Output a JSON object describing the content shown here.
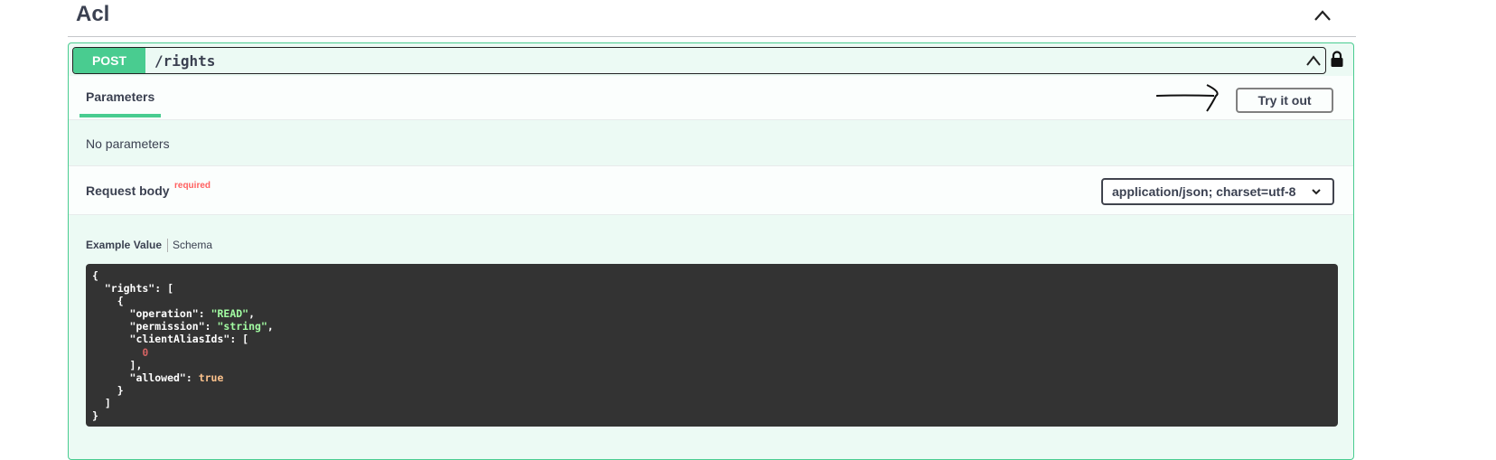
{
  "tag": {
    "title": "Acl"
  },
  "operation": {
    "method": "POST",
    "path": "/rights",
    "method_color": "#49cc90"
  },
  "parameters": {
    "tab_label": "Parameters",
    "try_button": "Try it out",
    "empty_text": "No parameters"
  },
  "request_body": {
    "title": "Request body",
    "required_label": "required",
    "content_type": "application/json; charset=utf-8"
  },
  "example": {
    "example_tab": "Example Value",
    "schema_tab": "Schema",
    "lines": [
      {
        "t": "{"
      },
      {
        "t": "  \"rights\": ["
      },
      {
        "t": "    {"
      },
      {
        "t": "      \"operation\": ",
        "v": "\"READ\"",
        "c": "s",
        "e": ","
      },
      {
        "t": "      \"permission\": ",
        "v": "\"string\"",
        "c": "s",
        "e": ","
      },
      {
        "t": "      \"clientAliasIds\": ["
      },
      {
        "t": "        ",
        "v": "0",
        "c": "n"
      },
      {
        "t": "      ],"
      },
      {
        "t": "      \"allowed\": ",
        "v": "true",
        "c": "b"
      },
      {
        "t": "    }"
      },
      {
        "t": "  ]"
      },
      {
        "t": "}"
      }
    ]
  },
  "icons": [
    "chevron-up-icon",
    "lock-icon",
    "arrow-icon",
    "chevron-down-icon"
  ]
}
